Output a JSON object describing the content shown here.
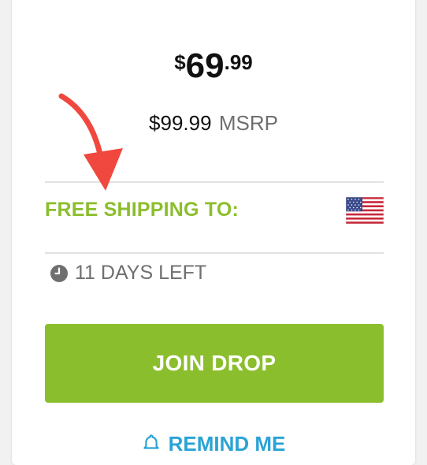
{
  "price": {
    "currency_symbol": "$",
    "dollars": "69",
    "cents": ".99"
  },
  "msrp": {
    "value": "$99.99",
    "label": "MSRP"
  },
  "shipping": {
    "label": "FREE SHIPPING TO:",
    "flag_icon": "us-flag-icon"
  },
  "timer": {
    "icon": "clock-icon",
    "text": "11 DAYS LEFT"
  },
  "join_button": {
    "label": "JOIN DROP"
  },
  "remind": {
    "icon": "bell-icon",
    "label": "REMIND ME"
  },
  "colors": {
    "accent_green": "#8bbe2c",
    "link_blue": "#2aa3d6",
    "annotation_red": "#f0473e",
    "muted_gray": "#6f6f6f"
  }
}
